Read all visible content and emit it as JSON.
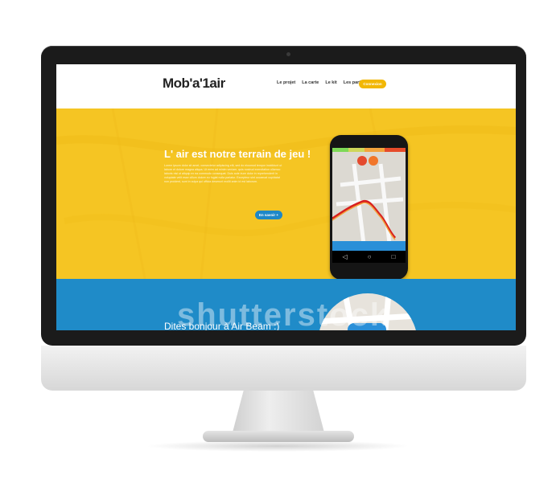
{
  "brand": {
    "logo": "Mob'a'1air",
    "accent_yellow": "#f5c523",
    "accent_blue": "#1f8bc8",
    "cta_yellow": "#f2b705"
  },
  "nav": {
    "links": [
      "Le projet",
      "La carte",
      "Le kit",
      "Les partenaires"
    ],
    "cta": "Connexion"
  },
  "hero": {
    "title": "L' air est notre terrain de jeu !",
    "body": "Lorem ipsum dolor sit amet, consectetur adipiscing elit, sed do eiusmod tempor incididunt ut labore et dolore magna aliqua. Ut enim ad minim veniam, quis nostrud exercitation ullamco laboris nisi ut aliquip ex ea commodo consequat. Duis aute irure dolor in reprehenderit in voluptate velit esse cillum dolore eu fugiat nulla pariatur. Excepteur sint occaecat cupidatat non proident, sunt in culpa qui officia deserunt mollit anim id est laborum.",
    "button": "En savoir +"
  },
  "phone_app": {
    "icons": [
      "menu-icon",
      "share-icon",
      "layers-icon",
      "settings-icon"
    ],
    "nav_icons": [
      "back-icon",
      "home-icon",
      "recent-icon"
    ]
  },
  "airbeam": {
    "title": "Dites bonjour à Air Beam :)"
  },
  "watermark": {
    "text": "shutterstock"
  }
}
